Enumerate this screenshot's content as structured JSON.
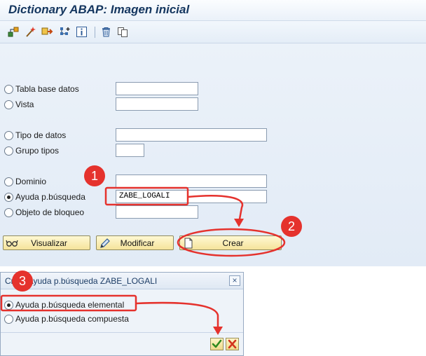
{
  "window": {
    "title": "Dictionary ABAP: Imagen inicial"
  },
  "toolbar": {
    "icons": [
      "hierarchy-icon",
      "magic-wand-icon",
      "transport-icon",
      "where-used-icon",
      "info-icon",
      "delete-icon",
      "copy-icon"
    ]
  },
  "options": [
    {
      "label": "Tabla base datos",
      "selected": false,
      "value": ""
    },
    {
      "label": "Vista",
      "selected": false,
      "value": ""
    },
    {
      "label": "Tipo de datos",
      "selected": false,
      "value": ""
    },
    {
      "label": "Grupo tipos",
      "selected": false,
      "value": ""
    },
    {
      "label": "Dominio",
      "selected": false,
      "value": ""
    },
    {
      "label": "Ayuda p.búsqueda",
      "selected": true,
      "value": "ZABE_LOGALI"
    },
    {
      "label": "Objeto de bloqueo",
      "selected": false,
      "value": ""
    }
  ],
  "buttons": {
    "display": "Visualizar",
    "change": "Modificar",
    "create": "Crear"
  },
  "dialog": {
    "title": "Crear Ayuda p.búsqueda ZABE_LOGALI",
    "options": [
      {
        "label": "Ayuda p.búsqueda elemental",
        "selected": true
      },
      {
        "label": "Ayuda p.búsqueda compuesta",
        "selected": false
      }
    ]
  },
  "annotations": {
    "step1": "1",
    "step2": "2",
    "step3": "3"
  },
  "colors": {
    "annotation": "#e5322d",
    "sap_blue": "#14365f",
    "button_yellow": "#f5e39a"
  }
}
